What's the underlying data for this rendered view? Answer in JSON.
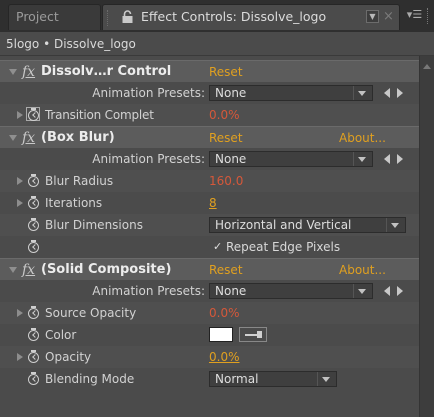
{
  "tabs": {
    "project": "Project",
    "effect_controls": "Effect Controls: Dissolve_logo"
  },
  "subheader": "5logo • Dissolve_logo",
  "icons": {
    "fx": "fx",
    "lock": "lock-icon",
    "stopwatch": "stopwatch-icon",
    "menu": "panel-menu-icon"
  },
  "effects": {
    "dissolve": {
      "name": "Dissolv…r Control",
      "reset": "Reset",
      "presets_label": "Animation Presets:",
      "presets_value": "None",
      "transition_label": "Transition Complet",
      "transition_value": "0.0%"
    },
    "boxblur": {
      "name": "(Box Blur)",
      "reset": "Reset",
      "about": "About...",
      "presets_label": "Animation Presets:",
      "presets_value": "None",
      "blur_radius_label": "Blur Radius",
      "blur_radius_value": "160.0",
      "iterations_label": "Iterations",
      "iterations_value": "8",
      "blur_dimensions_label": "Blur Dimensions",
      "blur_dimensions_value": "Horizontal and Vertical",
      "repeat_edge_label": "Repeat Edge Pixels",
      "repeat_edge_checked": true
    },
    "solid": {
      "name": "(Solid Composite)",
      "reset": "Reset",
      "about": "About...",
      "presets_label": "Animation Presets:",
      "presets_value": "None",
      "source_opacity_label": "Source Opacity",
      "source_opacity_value": "0.0%",
      "color_label": "Color",
      "color_value": "#ffffff",
      "opacity_label": "Opacity",
      "opacity_value": "0.0%",
      "blending_label": "Blending Mode",
      "blending_value": "Normal"
    }
  },
  "colors": {
    "accent": "#e0a020",
    "animated_value": "#d5583a"
  }
}
